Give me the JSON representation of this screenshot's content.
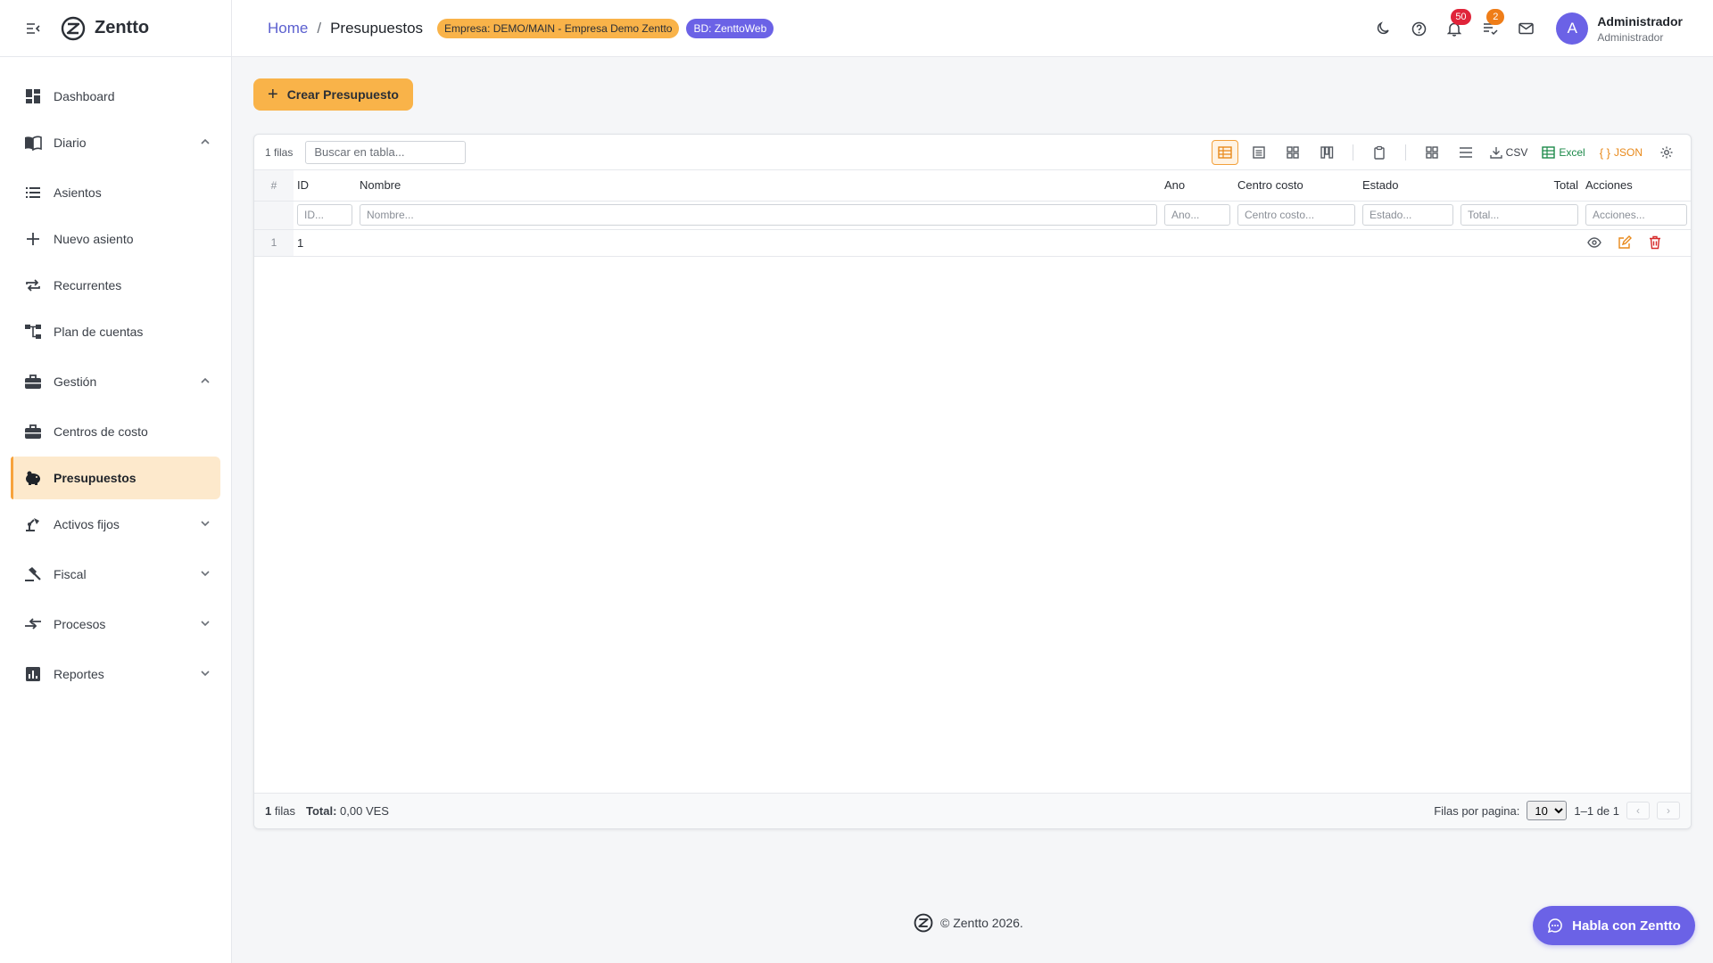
{
  "app": {
    "name": "Zentto"
  },
  "sidebar": {
    "items": [
      {
        "label": "Dashboard",
        "icon": "dashboard-icon"
      },
      {
        "label": "Diario",
        "icon": "book-icon",
        "expanded": true
      },
      {
        "label": "Asientos",
        "icon": "list-icon"
      },
      {
        "label": "Nuevo asiento",
        "icon": "plus-icon"
      },
      {
        "label": "Recurrentes",
        "icon": "repeat-icon"
      },
      {
        "label": "Plan de cuentas",
        "icon": "account-tree-icon"
      },
      {
        "label": "Gestión",
        "icon": "briefcase-icon",
        "expanded": true
      },
      {
        "label": "Centros de costo",
        "icon": "briefcase-icon"
      },
      {
        "label": "Presupuestos",
        "icon": "piggy-bank-icon",
        "active": true
      },
      {
        "label": "Activos fijos",
        "icon": "lamp-icon",
        "expanded": false
      },
      {
        "label": "Fiscal",
        "icon": "gavel-icon",
        "expanded": false
      },
      {
        "label": "Procesos",
        "icon": "compare-arrows-icon",
        "expanded": false
      },
      {
        "label": "Reportes",
        "icon": "bar-chart-icon",
        "expanded": false
      }
    ]
  },
  "header": {
    "breadcrumb": {
      "home": "Home",
      "separator": "/",
      "current": "Presupuestos"
    },
    "empresa_badge": "Empresa: DEMO/MAIN - Empresa Demo Zentto",
    "bd_badge": "BD: ZenttoWeb",
    "notifications_count": "50",
    "tasks_count": "2",
    "user": {
      "initial": "A",
      "name": "Administrador",
      "role": "Administrador"
    }
  },
  "main": {
    "create_button": "Crear Presupuesto",
    "table": {
      "rows_count": "1 filas",
      "search_placeholder": "Buscar en tabla...",
      "export": {
        "csv": "CSV",
        "excel": "Excel",
        "json": "JSON"
      },
      "columns": {
        "num": "#",
        "id": "ID",
        "nombre": "Nombre",
        "ano": "Ano",
        "centro": "Centro costo",
        "estado": "Estado",
        "total": "Total",
        "acciones": "Acciones"
      },
      "filters": {
        "id": "ID...",
        "nombre": "Nombre...",
        "ano": "Ano...",
        "centro": "Centro costo...",
        "estado": "Estado...",
        "total": "Total...",
        "acciones": "Acciones..."
      },
      "rows": [
        {
          "num": "1",
          "id": "1",
          "nombre": "",
          "ano": "",
          "centro": "",
          "estado": "",
          "total": ""
        }
      ],
      "footer": {
        "count_number": "1",
        "count_label": "filas",
        "total_label": "Total:",
        "total_value": "0,00 VES",
        "rows_per_page_label": "Filas por pagina:",
        "rows_per_page": "10",
        "range": "1–1 de 1",
        "prev": "‹",
        "next": "›"
      }
    }
  },
  "footer": {
    "copyright": "© Zentto 2026."
  },
  "chat": {
    "label": "Habla con Zentto"
  },
  "colors": {
    "accent": "#f9b349",
    "brand": "#6b62e6",
    "danger": "#e0243a",
    "link": "#5b5fcf"
  }
}
